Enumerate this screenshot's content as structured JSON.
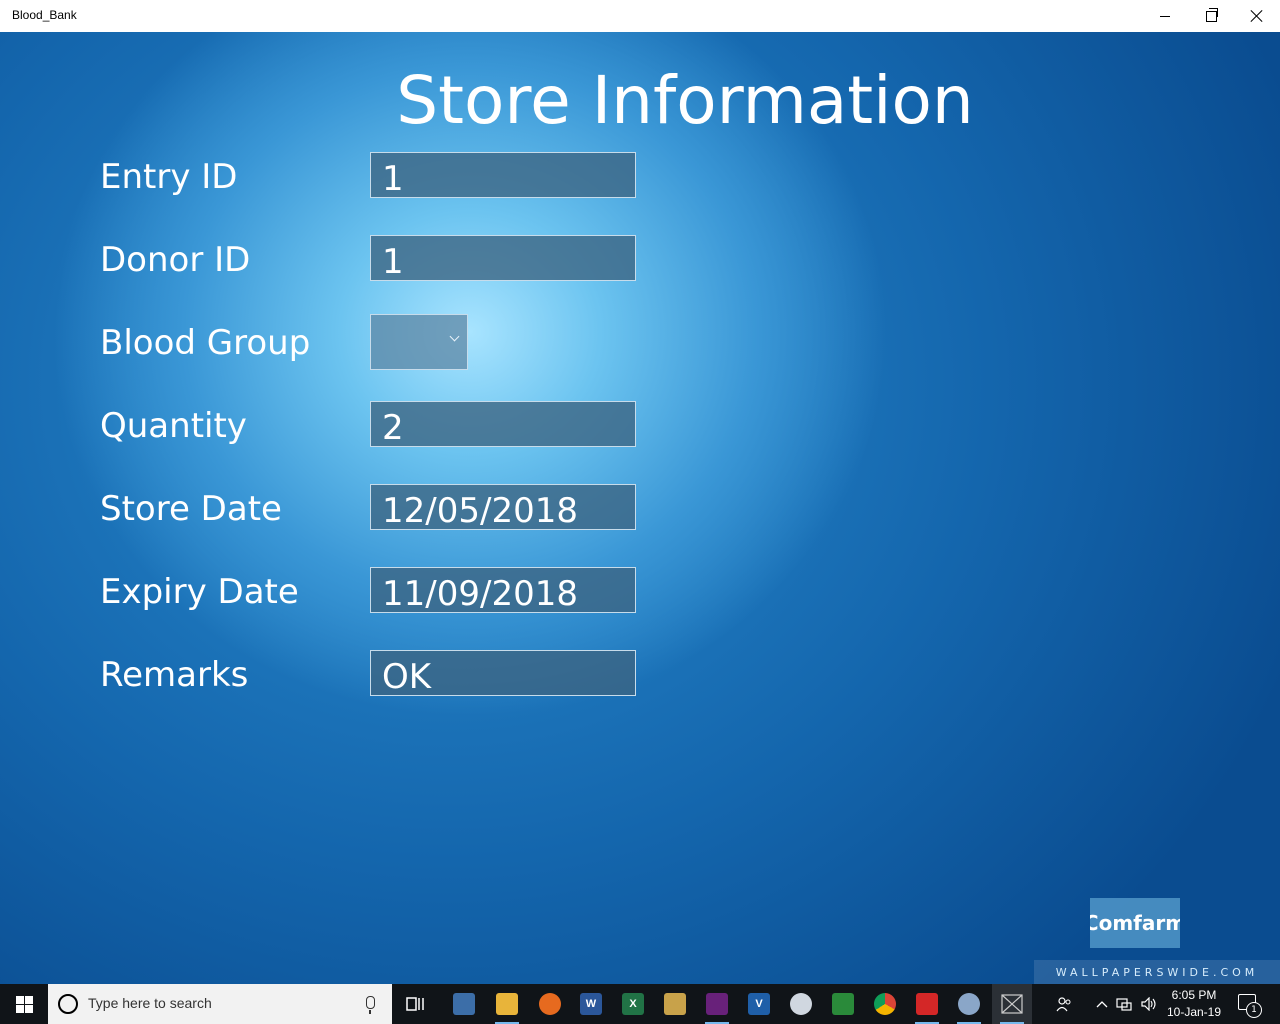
{
  "window": {
    "title": "Blood_Bank"
  },
  "page": {
    "title": "Store Information"
  },
  "form": {
    "entry_id": {
      "label": "Entry ID",
      "value": "1"
    },
    "donor_id": {
      "label": "Donor ID",
      "value": "1"
    },
    "blood_group": {
      "label": "Blood Group",
      "value": ""
    },
    "quantity": {
      "label": "Quantity",
      "value": "2"
    },
    "store_date": {
      "label": "Store Date",
      "value": "12/05/2018"
    },
    "expiry_date": {
      "label": "Expiry Date",
      "value": "11/09/2018"
    },
    "remarks": {
      "label": "Remarks",
      "value": "OK"
    }
  },
  "confirm_label": "Comfarm",
  "watermark": "WALLPAPERSWIDE.COM",
  "taskbar": {
    "search_placeholder": "Type here to search",
    "apps": [
      "task-view",
      "file-explorer",
      "firefox",
      "word",
      "excel",
      "sql-tool",
      "visual-studio",
      "vs-code",
      "paint",
      "vm-tool",
      "chrome",
      "acrobat",
      "paint-brush",
      "blood-bank-app"
    ],
    "clock_time": "6:05 PM",
    "clock_date": "10-Jan-19",
    "notification_count": "1"
  },
  "colors": {
    "accent": "#76b9ed",
    "taskbar": "#101418",
    "field_bg": "#3c6482"
  }
}
